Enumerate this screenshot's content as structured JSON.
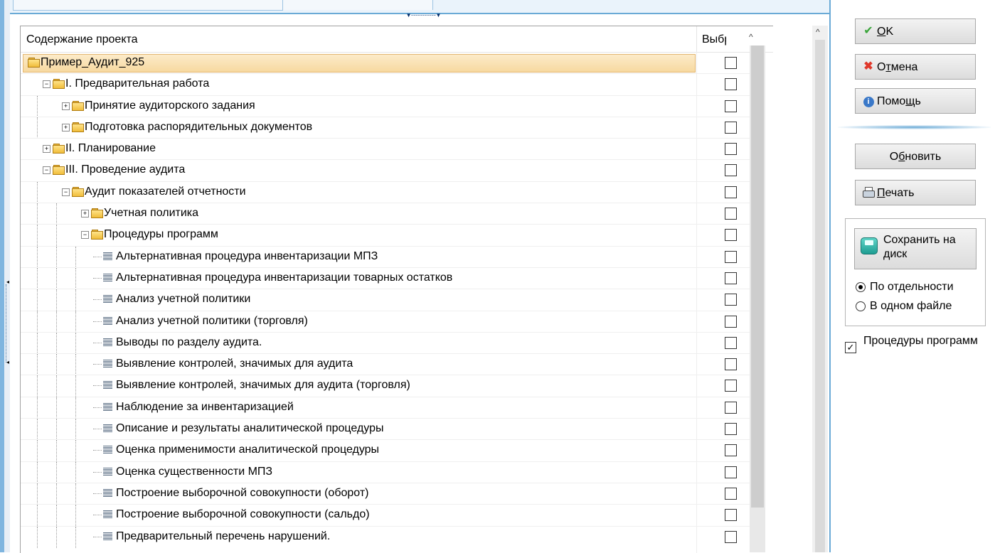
{
  "tree": {
    "header": {
      "col_content": "Содержание проекта",
      "col_selected": "Выбрать"
    },
    "rows": [
      {
        "label": "Пример_Аудит_925",
        "level": 0,
        "type": "folder",
        "expander": "",
        "selected": true
      },
      {
        "label": "I. Предварительная работа",
        "level": 1,
        "type": "folder",
        "expander": "−"
      },
      {
        "label": "Принятие аудиторского задания",
        "level": 2,
        "type": "folder",
        "expander": "+"
      },
      {
        "label": "Подготовка распорядительных документов",
        "level": 2,
        "type": "folder",
        "expander": "+"
      },
      {
        "label": "II. Планирование",
        "level": 1,
        "type": "folder",
        "expander": "+"
      },
      {
        "label": "III. Проведение аудита",
        "level": 1,
        "type": "folder",
        "expander": "−"
      },
      {
        "label": "Аудит показателей отчетности",
        "level": 2,
        "type": "folder",
        "expander": "−"
      },
      {
        "label": "Учетная политика",
        "level": 3,
        "type": "folder",
        "expander": "+"
      },
      {
        "label": "Процедуры программ",
        "level": 3,
        "type": "folder",
        "expander": "−"
      },
      {
        "label": "Альтернативная процедура инвентаризации МПЗ",
        "level": 4,
        "type": "doc"
      },
      {
        "label": "Альтернативная процедура инвентаризации товарных остатков",
        "level": 4,
        "type": "doc"
      },
      {
        "label": "Анализ учетной политики",
        "level": 4,
        "type": "doc"
      },
      {
        "label": "Анализ учетной политики (торговля)",
        "level": 4,
        "type": "doc"
      },
      {
        "label": "Выводы по разделу аудита.",
        "level": 4,
        "type": "doc"
      },
      {
        "label": "Выявление контролей, значимых для аудита",
        "level": 4,
        "type": "doc"
      },
      {
        "label": "Выявление контролей, значимых для аудита (торговля)",
        "level": 4,
        "type": "doc"
      },
      {
        "label": "Наблюдение за инвентаризацией",
        "level": 4,
        "type": "doc"
      },
      {
        "label": "Описание и результаты аналитической процедуры",
        "level": 4,
        "type": "doc"
      },
      {
        "label": "Оценка применимости аналитической процедуры",
        "level": 4,
        "type": "doc"
      },
      {
        "label": "Оценка существенности МПЗ",
        "level": 4,
        "type": "doc"
      },
      {
        "label": "Построение выборочной совокупности (оборот)",
        "level": 4,
        "type": "doc"
      },
      {
        "label": "Построение выборочной совокупности (сальдо)",
        "level": 4,
        "type": "doc"
      },
      {
        "label": "Предварительный перечень нарушений.",
        "level": 4,
        "type": "doc"
      }
    ]
  },
  "actions": {
    "ok": {
      "pre": "",
      "key": "O",
      "post": "K"
    },
    "cancel": {
      "pre": "О",
      "key": "т",
      "post": "мена"
    },
    "help": {
      "pre": "Помо",
      "key": "щ",
      "post": "ь"
    },
    "refresh": {
      "pre": "О",
      "key": "б",
      "post": "новить"
    },
    "print": {
      "pre": "",
      "key": "П",
      "post": "ечать"
    },
    "save": "Сохранить на диск"
  },
  "save_mode": {
    "separate": "По отдельности",
    "single": "В одном файле",
    "selected": "separate"
  },
  "procedures_checkbox": {
    "label": "Процедуры программ",
    "checked": true
  },
  "colors": {
    "accent": "#6aaad6",
    "selection": "#f7d9a0"
  }
}
